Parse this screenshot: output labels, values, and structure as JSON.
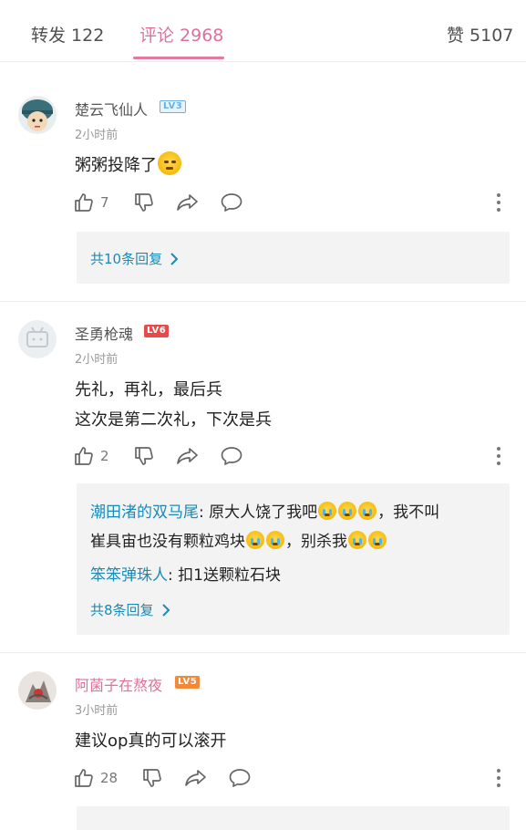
{
  "tabs": {
    "repost": "转发 122",
    "comments": "评论 2968",
    "likes": "赞 5107"
  },
  "comments": [
    {
      "username": "楚云飞仙人",
      "level": "LV3",
      "time": "2小时前",
      "lines": [
        "粥粥投降了"
      ],
      "like_count": "7",
      "reply_more": "共10条回复"
    },
    {
      "username": "圣勇枪魂",
      "level": "LV6",
      "time": "2小时前",
      "lines": [
        "先礼，再礼，最后兵",
        "这次是第二次礼，下次是兵"
      ],
      "like_count": "2",
      "replies": [
        {
          "name": "潮田渚的双马尾",
          "text1": ": 原大人饶了我吧",
          "text2": "，我不叫",
          "text3": "崔具宙也没有颗粒鸡块",
          "text4": "，别杀我"
        },
        {
          "name": "笨笨弹珠人",
          "text": ": 扣1送颗粒石块"
        }
      ],
      "reply_more": "共8条回复"
    },
    {
      "username": "阿菌子在熬夜",
      "level": "LV5",
      "time": "3小时前",
      "lines": [
        "建议op真的可以滚开"
      ],
      "like_count": "28"
    }
  ],
  "icons": {
    "like": "thumb-up-icon",
    "dislike": "thumb-down-icon",
    "share": "share-arrow-icon",
    "reply": "speech-bubble-icon",
    "more": "more-vertical-icon",
    "chevron": "chevron-right-icon"
  },
  "colors": {
    "accent": "#e0709a",
    "link": "#1a8bb6",
    "lv3": "#6ab0e6",
    "lv6": "#e84a4a",
    "lv5": "#f0893a"
  }
}
